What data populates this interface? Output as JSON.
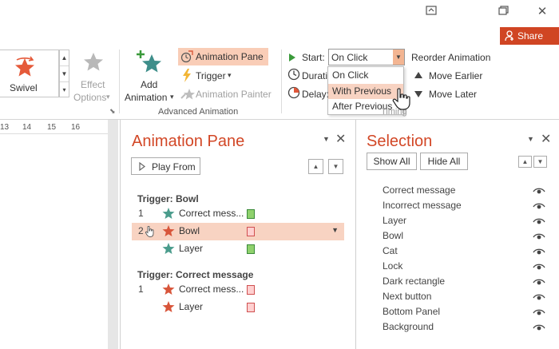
{
  "window": {
    "restore_icon": "restore-window-icon",
    "maximize_icon": "maximize-icon",
    "close_icon": "close-icon"
  },
  "share": {
    "label": "Share"
  },
  "ribbon": {
    "gallery": {
      "selected": "Swivel"
    },
    "effect_options": {
      "label1": "Effect",
      "label2": "Options",
      "arrow": "▾"
    },
    "add_animation": {
      "label1": "Add",
      "label2": "Animation",
      "arrow": "▾"
    },
    "animation_pane": "Animation Pane",
    "trigger": "Trigger",
    "trigger_arrow": "▾",
    "animation_painter": "Animation Painter",
    "group_label": "Advanced Animation",
    "start": {
      "label": "Start:",
      "value": "On Click",
      "options": [
        "On Click",
        "With Previous",
        "After Previous"
      ],
      "highlighted": "With Previous"
    },
    "duration": {
      "label": "Durati"
    },
    "delay": {
      "label": "Delay:"
    },
    "timing_label_partial": "Timing",
    "reorder": {
      "title": "Reorder Animation",
      "earlier": "Move Earlier",
      "later": "Move Later"
    }
  },
  "ruler": {
    "ticks": [
      "13",
      "14",
      "15",
      "16"
    ]
  },
  "animation_pane": {
    "title": "Animation Pane",
    "play_from": "Play From",
    "groups": [
      {
        "trigger": "Trigger: Bowl",
        "items": [
          {
            "num": "1",
            "label": "Correct mess...",
            "star": "#4a9c8c",
            "bar_fill": "#8fd16d",
            "bar_border": "#3a8a3a"
          },
          {
            "num": "2",
            "label": "Bowl",
            "star": "#d8553a",
            "bar_fill": "#ffd0d0",
            "bar_border": "#d05050",
            "selected": true
          },
          {
            "num": "",
            "label": "Layer",
            "star": "#4a9c8c",
            "bar_fill": "#8fd16d",
            "bar_border": "#3a8a3a"
          }
        ]
      },
      {
        "trigger": "Trigger: Correct message",
        "items": [
          {
            "num": "1",
            "label": "Correct mess...",
            "star": "#d8553a",
            "bar_fill": "#ffd0d0",
            "bar_border": "#d05050"
          },
          {
            "num": "",
            "label": "Layer",
            "star": "#d8553a",
            "bar_fill": "#ffd0d0",
            "bar_border": "#d05050"
          }
        ]
      }
    ]
  },
  "selection_pane": {
    "title": "Selection",
    "show_all": "Show All",
    "hide_all": "Hide All",
    "items": [
      "Correct message",
      "Incorrect message",
      "Layer",
      "Bowl",
      "Cat",
      "Lock",
      "Dark rectangle",
      "Next button",
      "Bottom Panel",
      "Background"
    ]
  },
  "colors": {
    "accent": "#d24726",
    "share_bg": "#d04523",
    "highlight": "#f8d3c2",
    "button_highlight": "#f9cdb7"
  }
}
